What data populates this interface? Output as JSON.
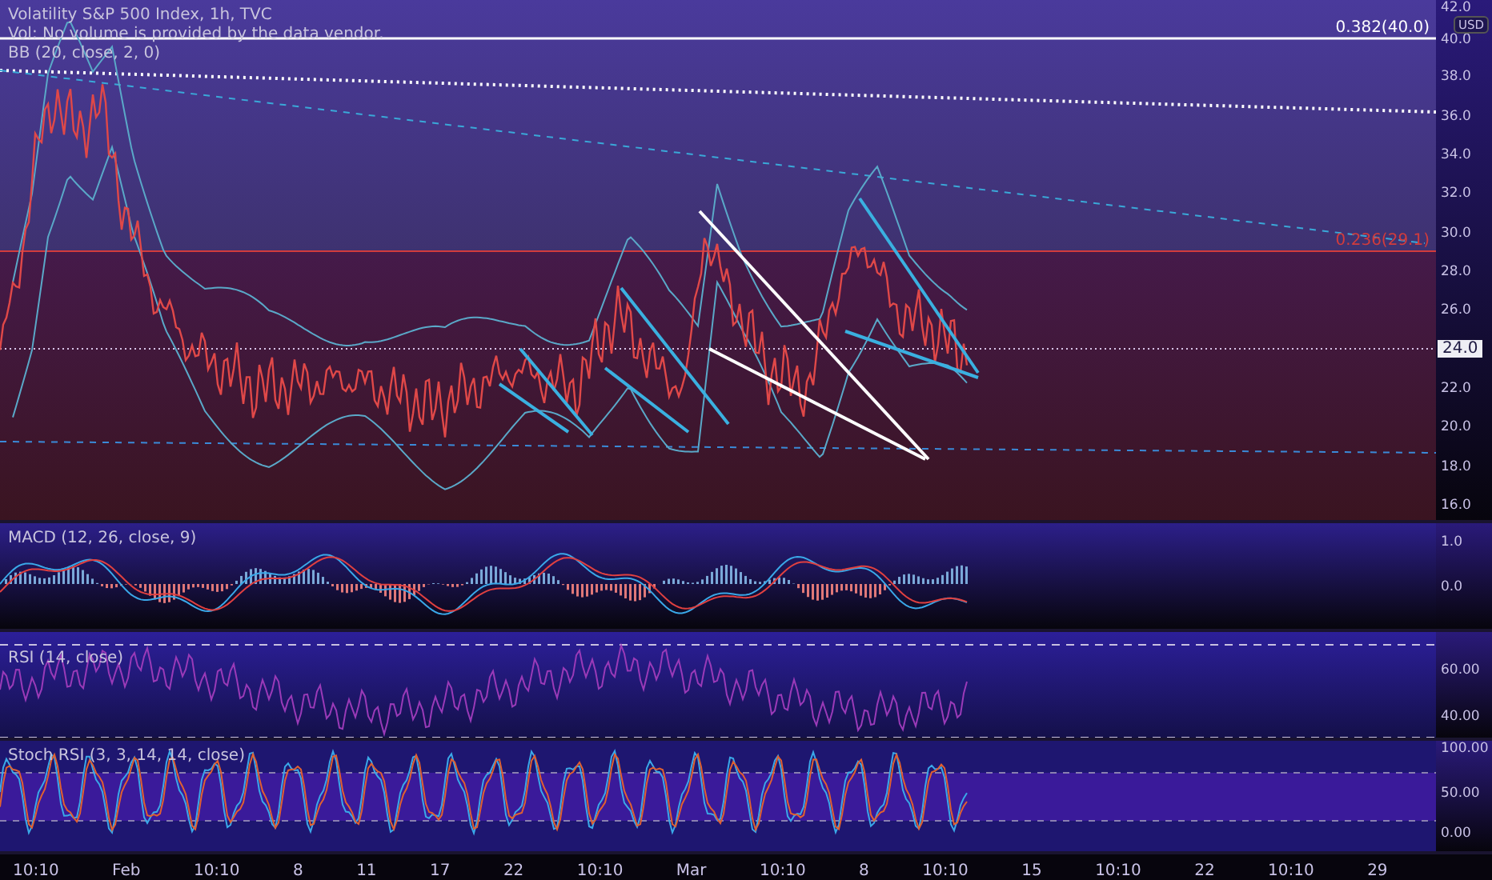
{
  "header": {
    "title": "Volatility S&P 500 Index, 1h, TVC",
    "volume_note": "Vol: No volume is provided by the data vendor.",
    "bb_legend": "BB (20, close, 2, 0)"
  },
  "price_axis": {
    "currency": "USD",
    "ticks": [
      "42.0",
      "40.0",
      "38.0",
      "36.0",
      "34.0",
      "32.0",
      "30.0",
      "28.0",
      "26.0",
      "22.0",
      "20.0",
      "18.0",
      "16.0"
    ],
    "current_price": "24.0"
  },
  "fib_levels": [
    {
      "label": "0.382(40.0)",
      "color": "#ffffff"
    },
    {
      "label": "0.236(29.1)",
      "color": "#d23c3c"
    }
  ],
  "indicators": [
    {
      "kind": "macd",
      "legend": "MACD (12, 26, close, 9)",
      "ticks": [
        "1.0",
        "0.0"
      ]
    },
    {
      "kind": "rsi",
      "legend": "RSI (14, close)",
      "ticks": [
        "60.00",
        "40.00"
      ]
    },
    {
      "kind": "stoch",
      "legend": "Stoch RSI (3, 3, 14, 14, close)",
      "ticks": [
        "100.00",
        "50.00",
        "0.00"
      ]
    }
  ],
  "time_axis": {
    "labels": [
      "10:10",
      "Feb",
      "10:10",
      "8",
      "11",
      "17",
      "22",
      "10:10",
      "Mar",
      "10:10",
      "8",
      "10:10",
      "15",
      "10:10",
      "22",
      "10:10",
      "29"
    ]
  }
}
